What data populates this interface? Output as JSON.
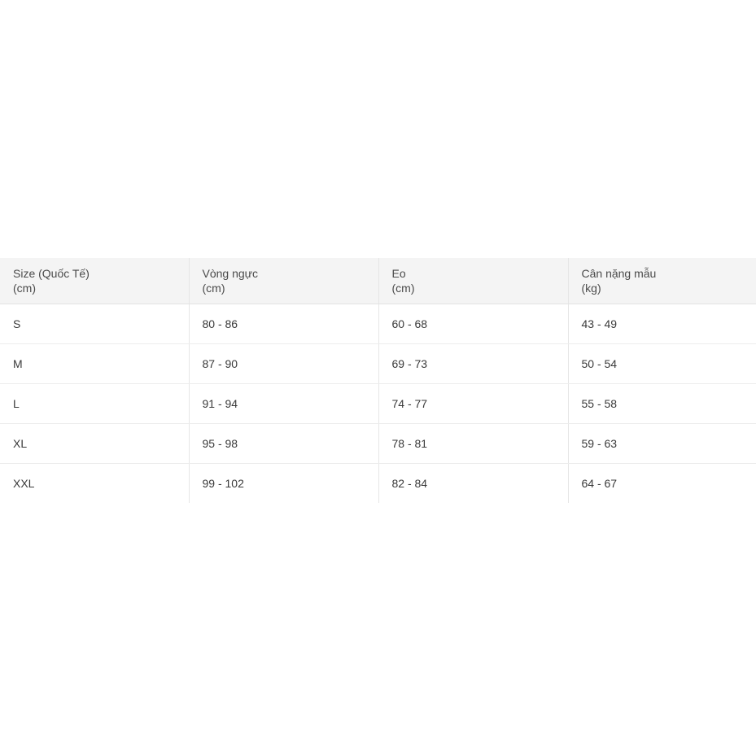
{
  "size_table": {
    "headers": [
      {
        "line1": "Size (Quốc Tế)",
        "line2": "(cm)"
      },
      {
        "line1": "Vòng ngực",
        "line2": "(cm)"
      },
      {
        "line1": "Eo",
        "line2": "(cm)"
      },
      {
        "line1": "Cân nặng mẫu",
        "line2": "(kg)"
      }
    ],
    "rows": [
      [
        "S",
        "80 - 86",
        "60 - 68",
        "43 - 49"
      ],
      [
        "M",
        "87 - 90",
        "69 - 73",
        "50 - 54"
      ],
      [
        "L",
        "91 - 94",
        "74 - 77",
        "55 - 58"
      ],
      [
        "XL",
        "95 - 98",
        "78 - 81",
        "59 - 63"
      ],
      [
        "XXL",
        "99 - 102",
        "82 - 84",
        "64 - 67"
      ]
    ]
  }
}
